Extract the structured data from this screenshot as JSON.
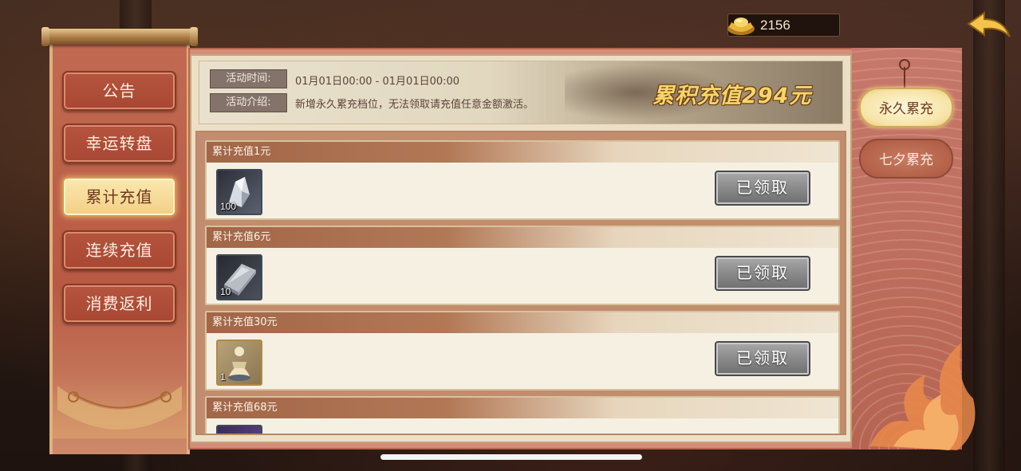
{
  "currency": {
    "icon": "gold-ingot-icon",
    "amount": "2156"
  },
  "nav_tabs": [
    {
      "label": "公告",
      "active": false
    },
    {
      "label": "幸运转盘",
      "active": false
    },
    {
      "label": "累计充值",
      "active": true
    },
    {
      "label": "连续充值",
      "active": false
    },
    {
      "label": "消费返利",
      "active": false
    }
  ],
  "banner": {
    "time_label": "活动时间:",
    "time_value": "01月01日00:00 - 01月01日00:00",
    "intro_label": "活动介绍:",
    "intro_value": "新增永久累充档位，无法领取请充值任意金额激活。",
    "total": "累积充值294元"
  },
  "rewards": [
    {
      "title": "累计充值1元",
      "item_icon": "crystal-ore-icon",
      "count": "100",
      "button": "已领取"
    },
    {
      "title": "累计充值6元",
      "item_icon": "silver-ingot-icon",
      "count": "10",
      "button": "已领取"
    },
    {
      "title": "累计充值30元",
      "item_icon": "warrior-figure-icon",
      "count": "1",
      "button": "已领取"
    },
    {
      "title": "累计充值68元"
    }
  ],
  "side_tabs": [
    {
      "label": "永久累充",
      "active": true
    },
    {
      "label": "七夕累充",
      "active": false
    }
  ],
  "colors": {
    "accent_gold": "#f6d56a",
    "panel_red": "#b85a43",
    "claimed_gray": "#8a8a8a"
  }
}
